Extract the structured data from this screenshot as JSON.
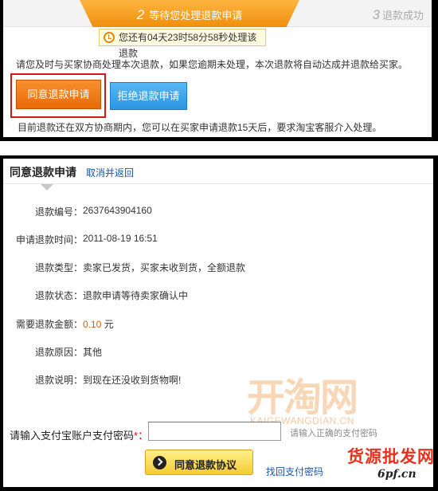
{
  "steps": {
    "current": {
      "num": "2",
      "label": "等待您处理退款申请"
    },
    "next": {
      "num": "3",
      "label": "退款成功"
    }
  },
  "timer": {
    "text": "您还有04天23时58分58秒处理该退款"
  },
  "notice": "请您及时与买家协商处理本次退款，如果您逾期未处理，本次退款将自动达成并退款给买家。",
  "buttons": {
    "agree": "同意退款申请",
    "reject": "拒绝退款申请"
  },
  "footer_note": "目前退款还在双方协商期内，您可以在买家申请退款15天后，要求淘宝客服介入处理。",
  "panel": {
    "title": "同意退款申请",
    "cancel_link": "取消并返回"
  },
  "details": [
    {
      "label": "退款编号：",
      "value": "2637643904160"
    },
    {
      "label": "申请退款时间：",
      "value": "2011-08-19 16:51"
    },
    {
      "label": "退款类型：",
      "value": "卖家已发货，买家未收到货，全额退款"
    },
    {
      "label": "退款状态：",
      "value": "退款申请等待卖家确认中"
    },
    {
      "label": "需要退款金额：",
      "amount": "0.10",
      "unit": "元"
    },
    {
      "label": "退款原因：",
      "value": "其他"
    },
    {
      "label": "退款说明：",
      "value": "到现在还没收到货物啊!"
    }
  ],
  "watermark": {
    "main": "开淘网",
    "sub": "KAIGEWANGDIAN.CN"
  },
  "password": {
    "label": "请输入支付宝账户支付密码",
    "required_mark": "*：",
    "value": "",
    "hint": "请输入正确的支付密码"
  },
  "protocol_button": "同意退款协议",
  "find_password_link": "找回支付密码",
  "logo": {
    "text": "货源批发网",
    "url": "6pf.cn"
  },
  "colors": {
    "accent_orange": "#f08e0c",
    "reject_blue": "#2d94e4",
    "link_blue": "#1a56a8",
    "amount_orange": "#e05a00",
    "outline_red": "#d61616"
  }
}
